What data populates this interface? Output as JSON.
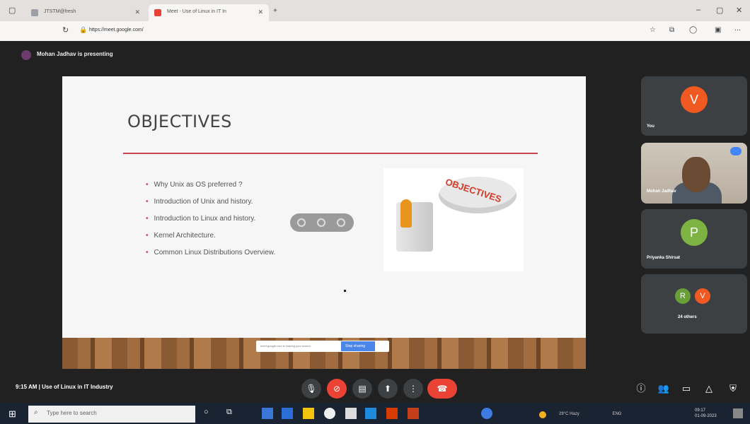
{
  "browser": {
    "tabs": [
      {
        "label": "JTSTM@fresh"
      },
      {
        "label": "Meet - Use of Linux in IT In"
      }
    ],
    "url": "https://meet.google.com/",
    "new_tab": "+",
    "menu": "..."
  },
  "meet": {
    "presenting_text": "Mohan Jadhav is presenting",
    "slide": {
      "title": "OBJECTIVES",
      "bullets": [
        "Why Unix as OS preferred ?",
        "Introduction of Unix and history.",
        "Introduction to Linux and history.",
        "Kernel Architecture.",
        "Common Linux Distributions Overview."
      ],
      "image_text": "OBJECTIVES"
    },
    "stop_share_text": "meet.google.com is sharing your screen.",
    "stop_share_button": "Stop sharing"
  },
  "participants": [
    {
      "initial": "V",
      "name": "You",
      "color": "#f05a22"
    },
    {
      "name": "Mohan Jadhav"
    },
    {
      "initial": "P",
      "name": "Priyanka Shirsat",
      "color": "#7cb342"
    },
    {
      "initials": [
        "R",
        "V"
      ],
      "label": "24 others",
      "colors": [
        "#689f38",
        "#f05a22"
      ]
    }
  ],
  "bottom_bar": {
    "time": "9:15 AM",
    "separator": "|",
    "meeting_name": "Use of Linux in IT Industry"
  },
  "taskbar": {
    "search_placeholder": "Type here to search",
    "weather": "29°C Hazy",
    "clock_time": "09:17",
    "clock_date": "01-09-2023",
    "lang": "ENG"
  }
}
